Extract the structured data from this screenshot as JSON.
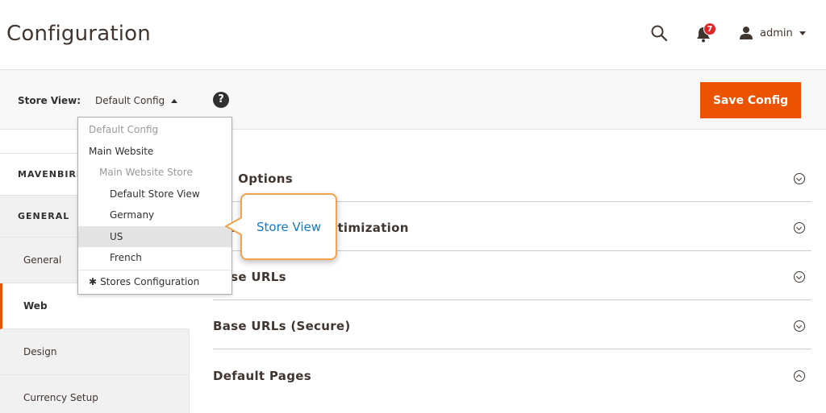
{
  "header": {
    "title": "Configuration",
    "notifications_count": "7",
    "user_name": "admin"
  },
  "store_bar": {
    "label": "Store View:",
    "current": "Default Config",
    "help": "?",
    "save_label": "Save Config"
  },
  "store_dropdown": {
    "items": [
      {
        "label": "Default Config",
        "level": 0,
        "disabled": true
      },
      {
        "label": "Main Website",
        "level": 0,
        "disabled": false
      },
      {
        "label": "Main Website Store",
        "level": 1,
        "disabled": true
      },
      {
        "label": "Default Store View",
        "level": 2,
        "disabled": false
      },
      {
        "label": "Germany",
        "level": 2,
        "disabled": false
      },
      {
        "label": "US",
        "level": 2,
        "disabled": false,
        "selected": true
      },
      {
        "label": "French",
        "level": 2,
        "disabled": false
      }
    ],
    "config_link": "Stores Configuration"
  },
  "callout": {
    "text": "Store View"
  },
  "sidebar": {
    "sections": [
      {
        "label": "MAVENBIRD"
      },
      {
        "label": "GENERAL"
      }
    ],
    "items": [
      {
        "label": "General",
        "active": false
      },
      {
        "label": "Web",
        "active": true
      },
      {
        "label": "Design",
        "active": false
      },
      {
        "label": "Currency Setup",
        "active": false
      }
    ]
  },
  "main": {
    "groups": [
      {
        "title": "Url Options",
        "expanded": false
      },
      {
        "title": "Search Engine Optimization",
        "expanded": false
      },
      {
        "title": "Base URLs",
        "expanded": false
      },
      {
        "title": "Base URLs (Secure)",
        "expanded": false
      },
      {
        "title": "Default Pages",
        "expanded": true
      }
    ]
  },
  "colors": {
    "accent": "#eb5202",
    "callout_border": "#f1a24a",
    "callout_text": "#1979c3",
    "badge": "#e22626"
  }
}
